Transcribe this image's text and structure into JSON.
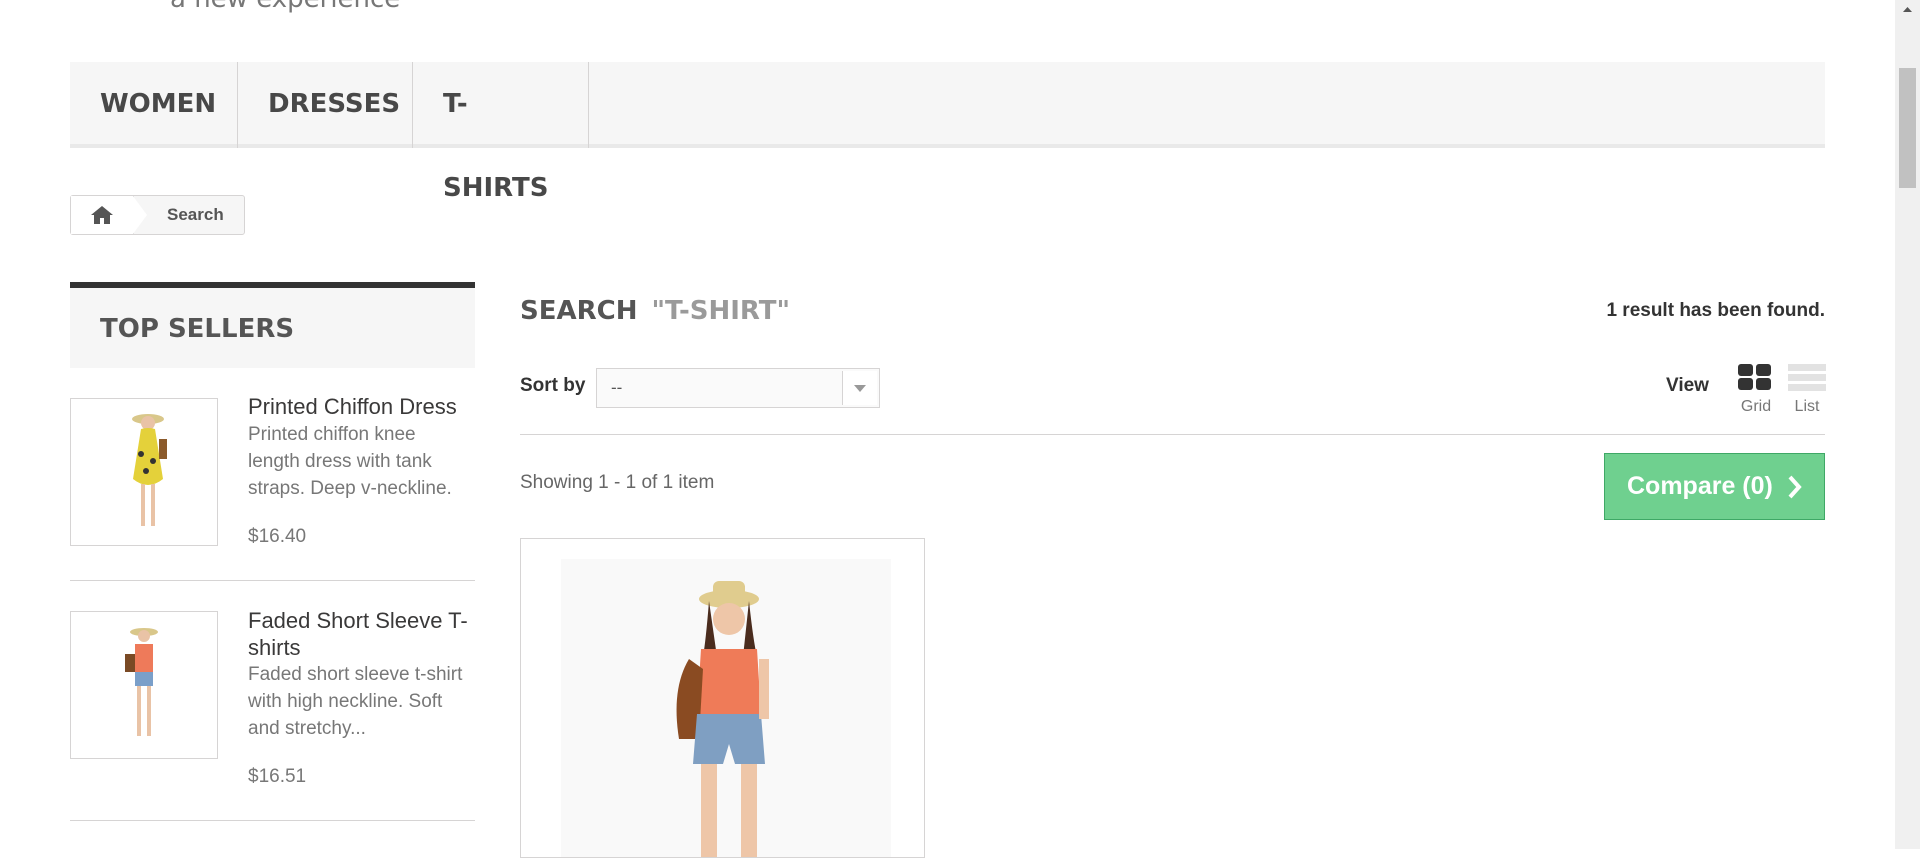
{
  "header": {
    "tagline": "a new experience"
  },
  "menu": {
    "items": [
      "WOMEN",
      "DRESSES",
      "T-SHIRTS"
    ]
  },
  "breadcrumb": {
    "current": "Search"
  },
  "sidebar": {
    "title": "TOP SELLERS",
    "products": [
      {
        "name": "Printed Chiffon Dress",
        "desc_lines": [
          "Printed chiffon knee",
          "length dress with tank",
          "straps. Deep v-neckline."
        ],
        "price": "$16.40"
      },
      {
        "name_lines": [
          "Faded Short Sleeve T-",
          "shirts"
        ],
        "desc_lines": [
          "Faded short sleeve t-shirt",
          "with high neckline. Soft",
          "and stretchy..."
        ],
        "price": "$16.51"
      }
    ]
  },
  "main": {
    "heading": "SEARCH",
    "query": "\"T-SHIRT\"",
    "result_count": "1 result has been found.",
    "sort_label": "Sort by",
    "sort_value": "--",
    "view_label": "View",
    "view_grid": "Grid",
    "view_list": "List",
    "showing": "Showing 1 - 1 of 1 item",
    "compare": "Compare (0)"
  },
  "icons": {
    "home": "home-icon",
    "chevron": "chevron-right-icon",
    "dropdown": "chevron-down-icon",
    "grid": "grid-icon",
    "list": "list-icon"
  }
}
